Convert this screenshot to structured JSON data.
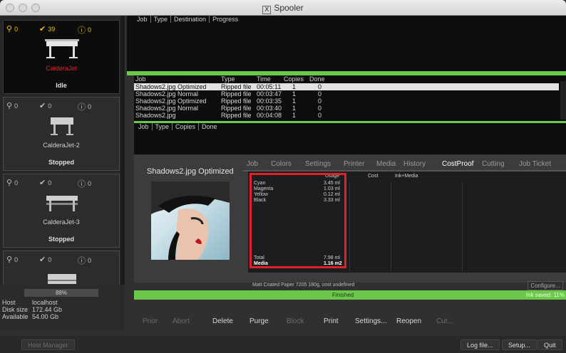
{
  "window": {
    "title": "Spooler"
  },
  "printers": [
    {
      "name": "CalderaJet",
      "status": "Idle",
      "keys": "0",
      "done": "39",
      "errors": "0"
    },
    {
      "name": "CalderaJet-2",
      "status": "Stopped",
      "keys": "0",
      "done": "0",
      "errors": "0"
    },
    {
      "name": "CalderaJet-3",
      "status": "Stopped",
      "keys": "0",
      "done": "0",
      "errors": "0"
    },
    {
      "name": "",
      "status": "",
      "keys": "0",
      "done": "0",
      "errors": "0"
    }
  ],
  "host": {
    "progress": "88%",
    "host_label": "Host",
    "host_value": "localhost",
    "disk_label": "Disk size",
    "disk_value": "172.44 Gb",
    "avail_label": "Available",
    "avail_value": "54.00 Gb"
  },
  "queue_top": {
    "headers": [
      "Job",
      "Type",
      "Destination",
      "Progress"
    ]
  },
  "queue_mid": {
    "headers": [
      "Job",
      "Type",
      "Time",
      "Copies",
      "Done"
    ],
    "rows": [
      {
        "job": "Shadows2.jpg Optimized",
        "type": "Ripped file",
        "time": "00:05:11",
        "copies": "1",
        "done": "0"
      },
      {
        "job": "Shadows2.jpg Normal",
        "type": "Ripped file",
        "time": "00:03:47",
        "copies": "1",
        "done": "0"
      },
      {
        "job": "Shadows2.jpg Optimized",
        "type": "Ripped file",
        "time": "00:03:35",
        "copies": "1",
        "done": "0"
      },
      {
        "job": "Shadows2.jpg Normal",
        "type": "Ripped file",
        "time": "00:03:40",
        "copies": "1",
        "done": "0"
      },
      {
        "job": "Shadows2.jpg",
        "type": "Ripped file",
        "time": "00:04:08",
        "copies": "1",
        "done": "0"
      }
    ]
  },
  "queue_bottom": {
    "headers": [
      "Job",
      "Type",
      "Copies",
      "Done"
    ]
  },
  "detail": {
    "title": "Shadows2.jpg Optimized",
    "tabs": [
      "Job",
      "Colors",
      "Settings",
      "Printer",
      "Media",
      "History",
      "CostProof",
      "Cutting",
      "Job Ticket"
    ],
    "active_tab": "CostProof",
    "cost_headers": {
      "usage": "Usage",
      "cost": "Cost",
      "ink_media": "Ink+Media"
    },
    "inks": [
      {
        "name": "Cyan",
        "usage": "3.45 ml"
      },
      {
        "name": "Magenta",
        "usage": "1.03 ml"
      },
      {
        "name": "Yellow",
        "usage": "0.12 ml"
      },
      {
        "name": "Black",
        "usage": "3.33 ml"
      }
    ],
    "total": {
      "name": "Total",
      "usage": "7.98 ml"
    },
    "media": {
      "name": "Media",
      "usage": "1.16 m2"
    },
    "paper_note": "Matt Coated Paper 7205 180g, cost undefined",
    "configure": "Configure..."
  },
  "status_bar": {
    "text": "Finished",
    "ink_saved": "Ink saved: 11%"
  },
  "actions": [
    {
      "label": "Prior",
      "enabled": false
    },
    {
      "label": "Abort",
      "enabled": false
    },
    {
      "label": "Delete",
      "enabled": true
    },
    {
      "label": "Purge",
      "enabled": true
    },
    {
      "label": "Block",
      "enabled": false
    },
    {
      "label": "Print",
      "enabled": true
    },
    {
      "label": "Settings...",
      "enabled": true
    },
    {
      "label": "Reopen",
      "enabled": true
    },
    {
      "label": "Cut...",
      "enabled": false
    }
  ],
  "bottom": {
    "host_manager": "Host Manager",
    "log_file": "Log file...",
    "setup": "Setup...",
    "quit": "Quit"
  },
  "colors": {
    "accent_green": "#6cc84a",
    "highlight_red": "#e0212a",
    "check_yellow": "#f2c200"
  }
}
